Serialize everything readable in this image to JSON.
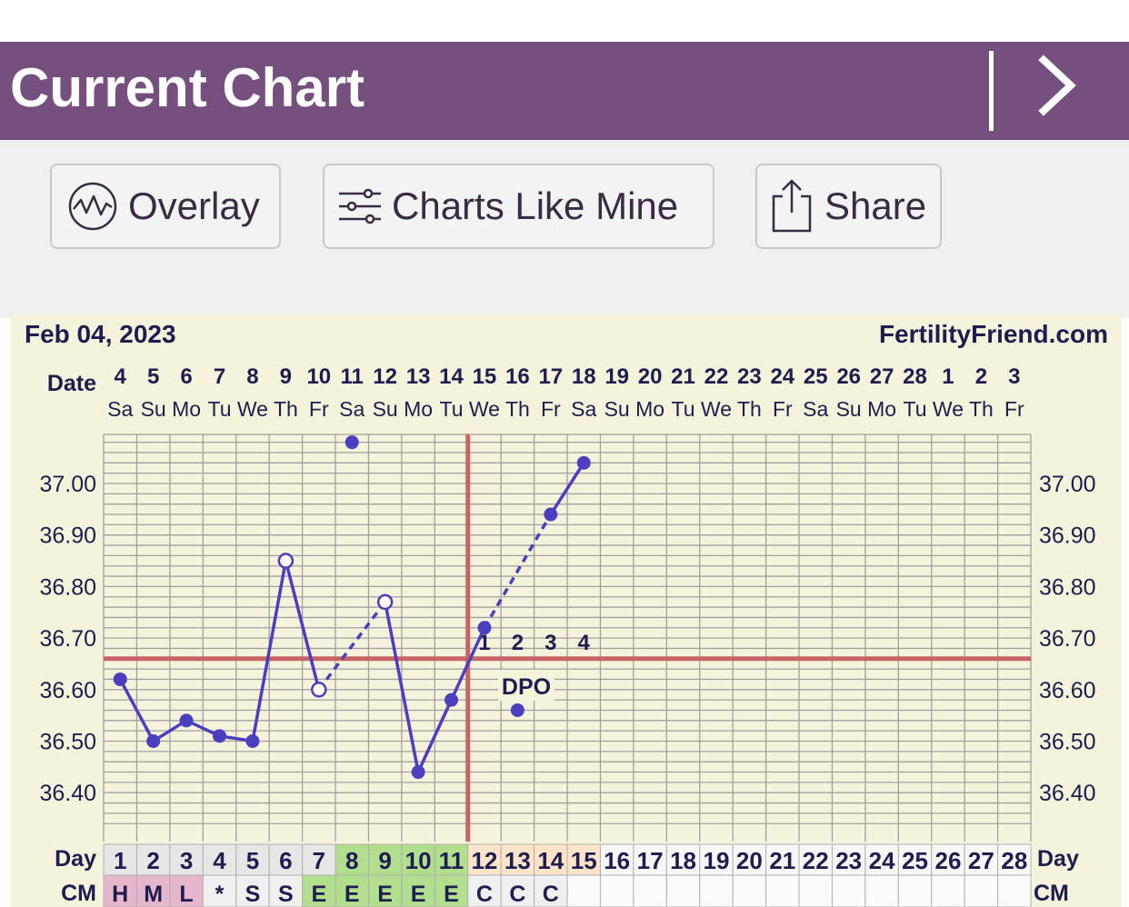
{
  "header": {
    "title": "Current Chart",
    "next_icon": "chevron-right-icon"
  },
  "toolbar": {
    "overlay_label": "Overlay",
    "overlay_icon": "overlay-chart-icon",
    "charts_like_mine_label": "Charts Like Mine",
    "charts_like_mine_icon": "sliders-icon",
    "share_label": "Share",
    "share_icon": "share-icon"
  },
  "colors": {
    "header_bg": "#75507f",
    "chart_bg": "#f6f3dc",
    "temp_line": "#4b3fc0",
    "coverline": "#c96464",
    "ovulation_line": "#c96464",
    "cm_mark": "#e6b6cc",
    "fertile": "#b2df8e",
    "luteal": "#fde4c8"
  },
  "chart_data": {
    "type": "line",
    "start_date": "Feb 04, 2023",
    "site": "FertilityFriend.com",
    "dates": [
      "4",
      "5",
      "6",
      "7",
      "8",
      "9",
      "10",
      "11",
      "12",
      "13",
      "14",
      "15",
      "16",
      "17",
      "18",
      "19",
      "20",
      "21",
      "22",
      "23",
      "24",
      "25",
      "26",
      "27",
      "28",
      "1",
      "2",
      "3"
    ],
    "weekdays": [
      "Sa",
      "Su",
      "Mo",
      "Tu",
      "We",
      "Th",
      "Fr",
      "Sa",
      "Su",
      "Mo",
      "Tu",
      "We",
      "Th",
      "Fr",
      "Sa",
      "Su",
      "Mo",
      "Tu",
      "We",
      "Th",
      "Fr",
      "Sa",
      "Su",
      "Mo",
      "Tu",
      "We",
      "Th",
      "Fr"
    ],
    "date_row_label": "Date",
    "cycle_days": [
      "1",
      "2",
      "3",
      "4",
      "5",
      "6",
      "7",
      "8",
      "9",
      "10",
      "11",
      "12",
      "13",
      "14",
      "15",
      "16",
      "17",
      "18",
      "19",
      "20",
      "21",
      "22",
      "23",
      "24",
      "25",
      "26",
      "27",
      "28"
    ],
    "day_row_label": "Day",
    "cm_row_label": "CM",
    "cm": [
      "H",
      "M",
      "L",
      "*",
      "S",
      "S",
      "E",
      "E",
      "E",
      "E",
      "E",
      "C",
      "C",
      "C",
      "",
      "",
      "",
      "",
      "",
      "",
      "",
      "",
      "",
      "",
      "",
      "",
      "",
      ""
    ],
    "cm_highlight": [
      "H",
      "M",
      "L"
    ],
    "fertile_days": [
      8,
      9,
      10,
      11
    ],
    "luteal_days": [
      12,
      13,
      14,
      15
    ],
    "y_ticks": [
      "37.00",
      "36.90",
      "36.80",
      "36.70",
      "36.60",
      "36.50",
      "36.40"
    ],
    "ylim": [
      36.34,
      37.1
    ],
    "coverline": 36.66,
    "ovulation_day": 11.5,
    "dpo_label": "DPO",
    "dpo_values": [
      "1",
      "2",
      "3",
      "4"
    ],
    "dpo_days": [
      12,
      13,
      14,
      15
    ],
    "temps": [
      {
        "day": 1,
        "temp": 36.62,
        "hollow": false
      },
      {
        "day": 2,
        "temp": 36.5,
        "hollow": false
      },
      {
        "day": 3,
        "temp": 36.54,
        "hollow": false
      },
      {
        "day": 4,
        "temp": 36.51,
        "hollow": false
      },
      {
        "day": 5,
        "temp": 36.5,
        "hollow": false
      },
      {
        "day": 6,
        "temp": 36.85,
        "hollow": true
      },
      {
        "day": 7,
        "temp": 36.6,
        "hollow": true
      },
      {
        "day": 8,
        "temp": 37.08,
        "hollow": false,
        "discarded": true
      },
      {
        "day": 9,
        "temp": 36.77,
        "hollow": true
      },
      {
        "day": 10,
        "temp": 36.44,
        "hollow": false
      },
      {
        "day": 11,
        "temp": 36.58,
        "hollow": false
      },
      {
        "day": 12,
        "temp": 36.72,
        "hollow": false
      },
      {
        "day": 13,
        "temp": 36.56,
        "hollow": false,
        "discarded": true
      },
      {
        "day": 14,
        "temp": 36.94,
        "hollow": false
      },
      {
        "day": 15,
        "temp": 37.04,
        "hollow": false
      }
    ],
    "solid_segments": [
      [
        1,
        2
      ],
      [
        2,
        3
      ],
      [
        3,
        4
      ],
      [
        4,
        5
      ],
      [
        5,
        6
      ],
      [
        6,
        7
      ],
      [
        9,
        10
      ],
      [
        10,
        11
      ],
      [
        11,
        12
      ],
      [
        14,
        15
      ]
    ],
    "dashed_segments": [
      [
        7,
        9
      ],
      [
        12,
        14
      ]
    ]
  }
}
